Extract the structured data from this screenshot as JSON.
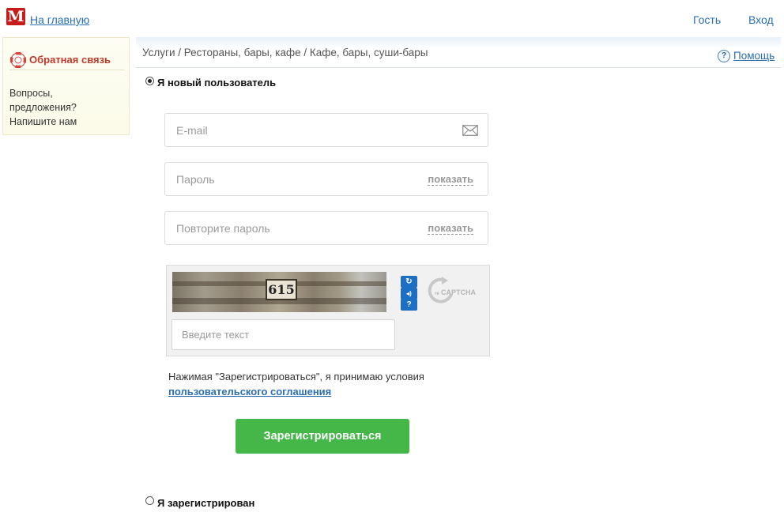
{
  "header": {
    "logo_letter": "M",
    "home_link": "На главную",
    "guest": "Гость",
    "login": "Вход"
  },
  "sidebar": {
    "title": "Обратная связь",
    "text_lines": [
      "Вопросы,",
      "предложения?",
      "Напишите нам"
    ]
  },
  "breadcrumb": "Услуги / Рестораны, бары, кафе / Кафе, бары, суши-бары",
  "help": {
    "icon": "?",
    "label": "Помощь"
  },
  "new_user": {
    "label": "Я новый пользователь",
    "selected": true
  },
  "form": {
    "email": {
      "value": "",
      "placeholder": "E-mail"
    },
    "password": {
      "value": "",
      "placeholder": "Пароль",
      "show_label": "показать"
    },
    "password_repeat": {
      "value": "",
      "placeholder": "Повторите пароль",
      "show_label": "показать"
    },
    "captcha": {
      "image_text": "615",
      "input_placeholder": "Введите текст",
      "refresh_icon": "↻",
      "audio_icon": "◂)",
      "help_icon": "?",
      "brand": "CAPTCHA",
      "brand_prefix": "re"
    },
    "terms_text": "Нажимая \"Зарегистрироваться\", я принимаю условия",
    "terms_link": "пользовательского соглашения",
    "submit_label": "Зарегистрироваться"
  },
  "registered_user": {
    "label": "Я зарегистрирован",
    "selected": false
  },
  "colors": {
    "brand_red": "#c61c1c",
    "link_blue": "#2a6fb3",
    "submit_green": "#45b749",
    "captcha_button_blue": "#1d6fc4"
  }
}
